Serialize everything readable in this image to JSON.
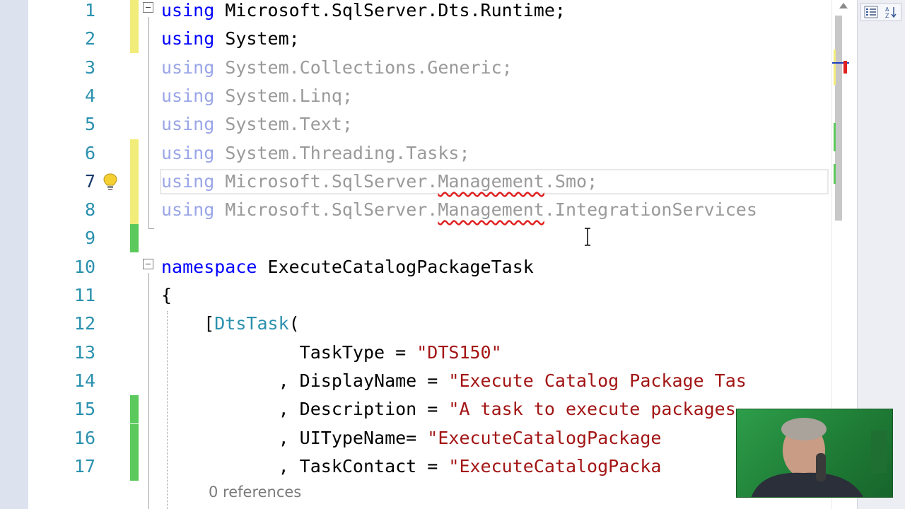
{
  "editor": {
    "lines": [
      {
        "n": "1",
        "change": "yellow",
        "fold": true,
        "tokens": [
          {
            "t": "using",
            "c": "kw"
          },
          {
            "t": " Microsoft.SqlServer.Dts.Runtime;",
            "c": "plain"
          }
        ]
      },
      {
        "n": "2",
        "change": "yellow",
        "fold": false,
        "tokens": [
          {
            "t": "using",
            "c": "kw"
          },
          {
            "t": " System;",
            "c": "plain"
          }
        ]
      },
      {
        "n": "3",
        "change": "none",
        "fold": false,
        "tokens": [
          {
            "t": "using",
            "c": "kwf"
          },
          {
            "t": " System.Collections.Generic;",
            "c": "faded"
          }
        ]
      },
      {
        "n": "4",
        "change": "none",
        "fold": false,
        "tokens": [
          {
            "t": "using",
            "c": "kwf"
          },
          {
            "t": " System.Linq;",
            "c": "faded"
          }
        ]
      },
      {
        "n": "5",
        "change": "none",
        "fold": false,
        "tokens": [
          {
            "t": "using",
            "c": "kwf"
          },
          {
            "t": " System.Text;",
            "c": "faded"
          }
        ]
      },
      {
        "n": "6",
        "change": "yellow",
        "fold": false,
        "tokens": [
          {
            "t": "using",
            "c": "kwf"
          },
          {
            "t": " System.Threading.Tasks;",
            "c": "faded"
          }
        ]
      },
      {
        "n": "7",
        "change": "yellow",
        "fold": false,
        "tokens": [
          {
            "t": "using",
            "c": "kwf"
          },
          {
            "t": " Microsoft.SqlServer.",
            "c": "faded"
          },
          {
            "t": "Management",
            "c": "faded squig"
          },
          {
            "t": ".Smo;",
            "c": "faded"
          }
        ]
      },
      {
        "n": "8",
        "change": "yellow",
        "fold": false,
        "tokens": [
          {
            "t": "using",
            "c": "kwf"
          },
          {
            "t": " Microsoft.SqlServer.",
            "c": "faded"
          },
          {
            "t": "Management",
            "c": "faded squig"
          },
          {
            "t": ".IntegrationServices",
            "c": "faded"
          }
        ]
      },
      {
        "n": "9",
        "change": "green",
        "fold": false,
        "tokens": []
      },
      {
        "n": "10",
        "change": "none",
        "fold": true,
        "tokens": [
          {
            "t": "namespace",
            "c": "kw"
          },
          {
            "t": " ExecuteCatalogPackageTask",
            "c": "plain"
          }
        ]
      },
      {
        "n": "11",
        "change": "none",
        "fold": false,
        "tokens": [
          {
            "t": "{",
            "c": "plain"
          }
        ]
      },
      {
        "n": "12",
        "change": "none",
        "fold": false,
        "tokens": [
          {
            "t": "    [",
            "c": "plain"
          },
          {
            "t": "DtsTask",
            "c": "type"
          },
          {
            "t": "(",
            "c": "plain"
          }
        ]
      },
      {
        "n": "13",
        "change": "none",
        "fold": false,
        "tokens": [
          {
            "t": "             TaskType = ",
            "c": "plain"
          },
          {
            "t": "\"DTS150\"",
            "c": "str"
          }
        ]
      },
      {
        "n": "14",
        "change": "none",
        "fold": false,
        "tokens": [
          {
            "t": "           , DisplayName = ",
            "c": "plain"
          },
          {
            "t": "\"Execute Catalog Package Tas",
            "c": "str"
          }
        ]
      },
      {
        "n": "15",
        "change": "green",
        "fold": false,
        "tokens": [
          {
            "t": "           , Description = ",
            "c": "plain"
          },
          {
            "t": "\"A task to execute packages",
            "c": "str"
          }
        ]
      },
      {
        "n": "16",
        "change": "green",
        "fold": false,
        "tokens": [
          {
            "t": "           , UITypeName= ",
            "c": "plain"
          },
          {
            "t": "\"ExecuteCatalogPackage",
            "c": "str"
          }
        ]
      },
      {
        "n": "17",
        "change": "green",
        "fold": false,
        "tokens": [
          {
            "t": "           , TaskContact = ",
            "c": "plain"
          },
          {
            "t": "\"ExecuteCatalogPacka",
            "c": "str"
          }
        ]
      }
    ],
    "active_line": "7",
    "codelens": "0 references"
  },
  "icons": {
    "lightbulb": "lightbulb-icon",
    "fold": "collapse-box-icon",
    "cursor": "ibeam-cursor-icon",
    "panel_left": "categorized-view-icon",
    "panel_right": "sort-alphabetical-icon"
  },
  "colors": {
    "keyword": "#0000ff",
    "keyword_faded": "#9aa6e8",
    "string": "#a31515",
    "type": "#2b91af",
    "line_number": "#2b91af",
    "change_unsaved": "#f2ec7a",
    "change_saved": "#5bc95b",
    "error_squiggle": "#e02020"
  }
}
